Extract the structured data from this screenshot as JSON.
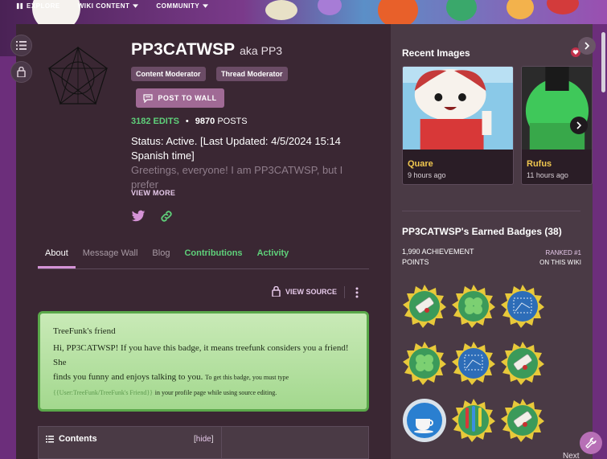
{
  "topnav": {
    "items": [
      {
        "label": "EXPLORE"
      },
      {
        "label": "WIKI CONTENT"
      },
      {
        "label": "COMMUNITY"
      }
    ]
  },
  "profile": {
    "username": "PP3CATWSP",
    "aka": "aka PP3",
    "tags": [
      "Content Moderator",
      "Thread Moderator"
    ],
    "post_button": "POST TO WALL",
    "edits": "3182 EDITS",
    "dot": "•",
    "posts_count": "9870",
    "posts_label": "POSTS",
    "bio_line1": "Status: Active. [Last Updated: 4/5/2024 15:14",
    "bio_line2": "Spanish time]",
    "bio_line3": "Greetings, everyone! I am PP3CATWSP, but I prefer",
    "view_more": "VIEW MORE"
  },
  "tabs": [
    {
      "label": "About"
    },
    {
      "label": "Message Wall"
    },
    {
      "label": "Blog"
    },
    {
      "label": "Contributions"
    },
    {
      "label": "Activity"
    }
  ],
  "toolbar": {
    "view_source": "VIEW SOURCE"
  },
  "friend_box": {
    "title": "TreeFunk's friend",
    "line1": "Hi, PP3CATWSP! If you have this badge, it means treefunk considers you a friend! She",
    "line2": "finds you funny and enjoys talking to you.",
    "line2_small": "To get this badge, you must type",
    "code": "{{User:TreeFunk/TreeFunk's Friend}}",
    "line3": "in your profile page while using source editing."
  },
  "contents": {
    "title": "Contents",
    "hide_open": "[",
    "hide": "hide",
    "hide_close": "]"
  },
  "rail": {
    "recent_images_title": "Recent Images",
    "images": [
      {
        "name": "Quare",
        "time": "9 hours ago"
      },
      {
        "name": "Rufus",
        "time": "11 hours ago"
      }
    ],
    "badges_title": "PP3CATWSP's Earned Badges (38)",
    "achievement_line1": "1,990 ACHIEVEMENT",
    "achievement_line2": "POINTS",
    "ranked_line1": "RANKED #1",
    "ranked_line2": "ON THIS WIKI",
    "next": "Next"
  },
  "colors": {
    "accent": "#d493d6",
    "green": "#5fd07a",
    "gold": "#f0c74f",
    "panel": "#3a2733"
  }
}
